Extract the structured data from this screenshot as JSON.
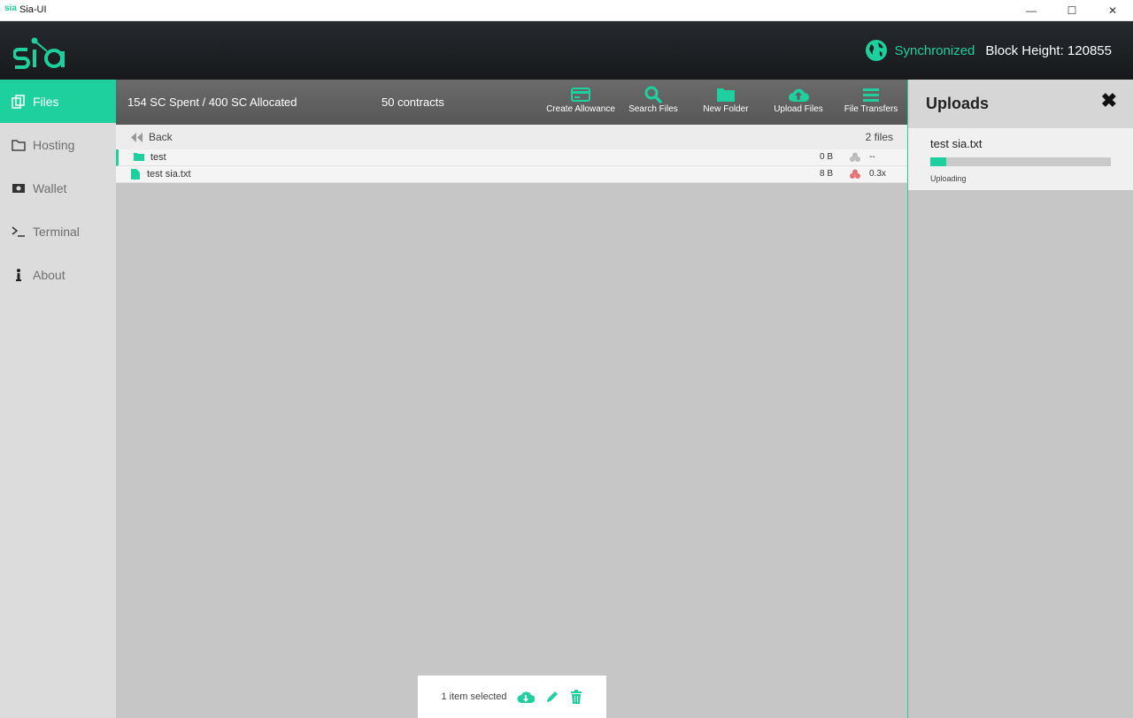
{
  "window": {
    "logo": "sia",
    "title": "Sia-UI",
    "minimize": "—",
    "maximize": "☐",
    "close": "✕"
  },
  "header": {
    "sync_status": "Synchronized",
    "block_height": "Block Height: 120855"
  },
  "sidebar": {
    "items": [
      {
        "label": "Files",
        "icon": "files-icon"
      },
      {
        "label": "Hosting",
        "icon": "folder-icon"
      },
      {
        "label": "Wallet",
        "icon": "wallet-icon"
      },
      {
        "label": "Terminal",
        "icon": "terminal-icon"
      },
      {
        "label": "About",
        "icon": "info-icon"
      }
    ]
  },
  "toolbar": {
    "spending": "154 SC Spent / 400 SC Allocated",
    "contracts": "50 contracts",
    "buttons": [
      {
        "label": "Create Allowance",
        "icon": "credit-card-icon"
      },
      {
        "label": "Search Files",
        "icon": "search-icon"
      },
      {
        "label": "New Folder",
        "icon": "new-folder-icon"
      },
      {
        "label": "Upload Files",
        "icon": "cloud-upload-icon"
      },
      {
        "label": "File Transfers",
        "icon": "menu-icon"
      }
    ]
  },
  "filelist": {
    "back_label": "Back",
    "count": "2 files",
    "rows": [
      {
        "name": "test",
        "size": "0 B",
        "redundancy": "--",
        "type": "folder"
      },
      {
        "name": "test sia.txt",
        "size": "8 B",
        "redundancy": "0.3x",
        "type": "file"
      }
    ]
  },
  "uploads": {
    "title": "Uploads",
    "close": "✖",
    "items": [
      {
        "name": "test sia.txt",
        "status": "Uploading",
        "progress": 0.09
      }
    ]
  },
  "selection": {
    "label": "1 item selected"
  },
  "colors": {
    "accent": "#1ed09d",
    "header_bg": "#1d2023",
    "content_bg": "#c6c6c6"
  }
}
